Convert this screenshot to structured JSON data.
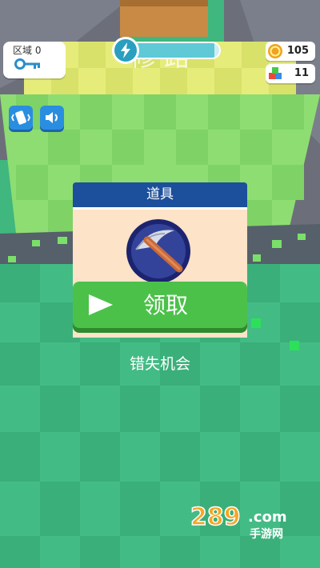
{
  "hud": {
    "zone_label": "区域 0",
    "energy_fraction": 0.95,
    "coins": "105",
    "gems": "11"
  },
  "overlay_text": "修 路",
  "dialog": {
    "title": "道具",
    "item_icon": "pickaxe-icon",
    "claim_label": "领取",
    "miss_label": "错失机会"
  },
  "watermark": "289.com 手游网",
  "colors": {
    "grass_light": "#7ed66a",
    "grass_dark": "#4fc08a",
    "panel_header": "#1c4f9c",
    "claim_button": "#4cc14a"
  }
}
